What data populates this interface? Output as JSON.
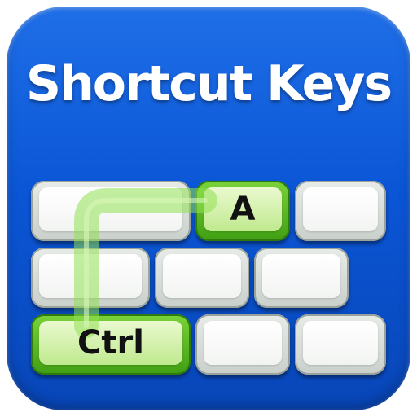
{
  "title": "Shortcut Keys",
  "keys": {
    "a_label": "A",
    "ctrl_label": "Ctrl"
  },
  "colors": {
    "background_blue": "#0b56d6",
    "key_green": "#5fbf23",
    "key_gray": "#dfe3df"
  },
  "icons": [
    "keyboard-icon"
  ]
}
